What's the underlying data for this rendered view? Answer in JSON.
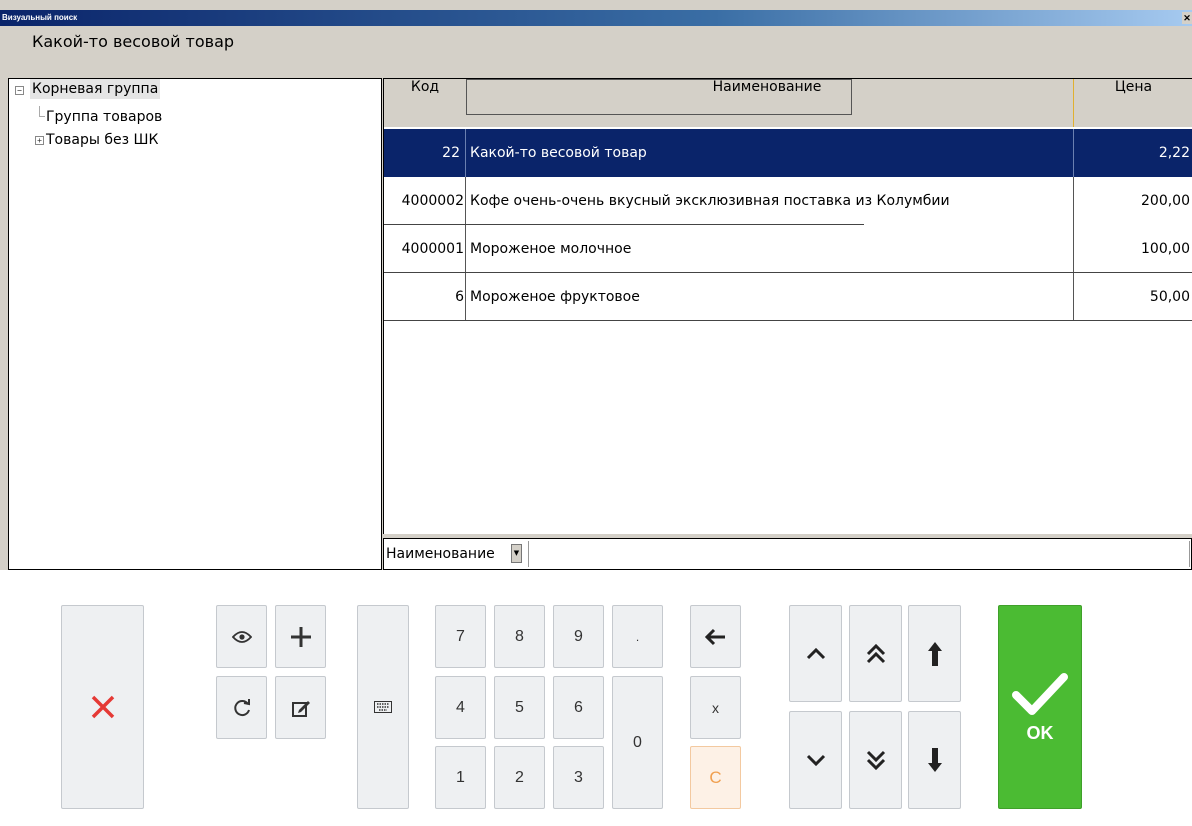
{
  "window": {
    "title": "Визуальный поиск",
    "close_glyph": "✕"
  },
  "caption": "Какой-то весовой товар",
  "tree": {
    "items": [
      {
        "label": "Корневая группа",
        "expander": "minus",
        "selected": true
      },
      {
        "label": "Группа товаров",
        "expander": "none"
      },
      {
        "label": "Товары без ШК",
        "expander": "plus"
      }
    ]
  },
  "grid": {
    "columns": {
      "code": "Код",
      "name": "Наименование",
      "price": "Цена"
    },
    "rows": [
      {
        "code": "22",
        "name": "Какой-то весовой товар",
        "price": "2,22",
        "selected": true
      },
      {
        "code": "4000002",
        "name": "Кофе очень-очень вкусный эксклюзивная поставка из Колумбии",
        "price": "200,00"
      },
      {
        "code": "4000001",
        "name": "Мороженое молочное",
        "price": "100,00"
      },
      {
        "code": "6",
        "name": "Мороженое фруктовое",
        "price": "50,00"
      }
    ]
  },
  "filter": {
    "field_label": "Наименование",
    "value": ""
  },
  "keypad": {
    "digits": {
      "k7": "7",
      "k8": "8",
      "k9": "9",
      "dot": ".",
      "k4": "4",
      "k5": "5",
      "k6": "6",
      "k0": "0",
      "k1": "1",
      "k2": "2",
      "k3": "3"
    },
    "multiply": "x",
    "clear": "C",
    "ok": "OK"
  },
  "colors": {
    "selection": "#0a246a",
    "ok": "#4bbb33",
    "cancel": "#e53935",
    "clear": "#f0a050"
  },
  "icons": [
    "cancel-icon",
    "eye-icon",
    "plus-icon",
    "refresh-icon",
    "edit-icon",
    "keyboard-icon",
    "backspace-icon",
    "chevron-up-icon",
    "double-chevron-up-icon",
    "arrow-up-icon",
    "chevron-down-icon",
    "double-chevron-down-icon",
    "arrow-down-icon",
    "check-icon"
  ]
}
